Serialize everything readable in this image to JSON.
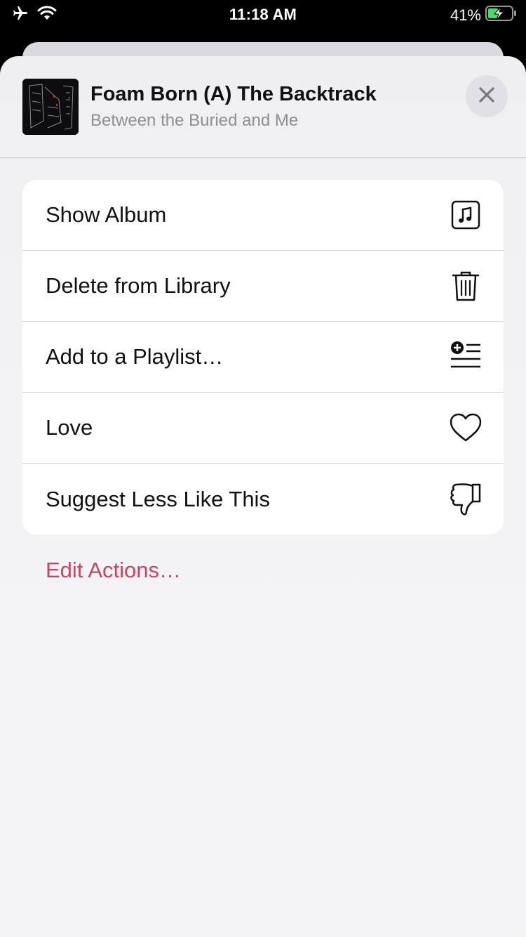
{
  "status_bar": {
    "time": "11:18 AM",
    "battery_percent": "41%",
    "icons": [
      "airplane-icon",
      "wifi-icon",
      "battery-charging-icon"
    ]
  },
  "header": {
    "title": "Foam Born (A) The Backtrack",
    "subtitle": "Between the Buried and Me",
    "close_icon": "close-icon"
  },
  "menu": {
    "items": [
      {
        "label": "Show Album",
        "icon": "album-icon"
      },
      {
        "label": "Delete from Library",
        "icon": "trash-icon"
      },
      {
        "label": "Add to a Playlist…",
        "icon": "add-to-playlist-icon"
      },
      {
        "label": "Love",
        "icon": "heart-icon"
      },
      {
        "label": "Suggest Less Like This",
        "icon": "thumbs-down-icon"
      }
    ]
  },
  "edit_actions_label": "Edit Actions…",
  "colors": {
    "accent": "#c8475f",
    "sheet_bg": "#f2f2f5",
    "card_bg": "#ffffff"
  }
}
